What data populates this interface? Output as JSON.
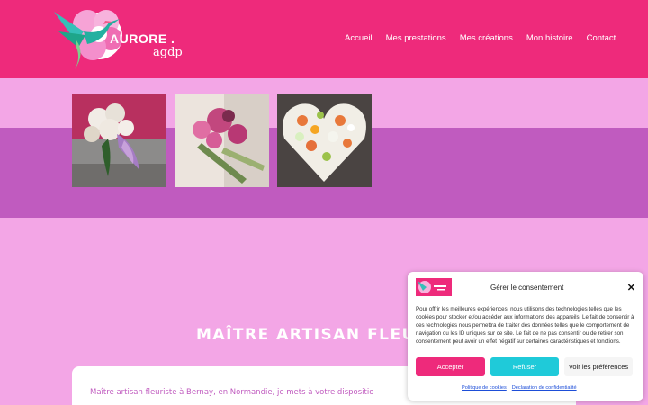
{
  "header": {
    "logo_word": "AURORE .",
    "logo_sub": "agdp",
    "nav": [
      "Accueil",
      "Mes prestations",
      "Mes créations",
      "Mon histoire",
      "Contact"
    ]
  },
  "gallery": {
    "images": [
      {
        "name": "bouquet-white-roses",
        "colors": [
          "#eae6e2",
          "#b58ac9",
          "#2f5e2b"
        ]
      },
      {
        "name": "bouquet-pink-lilies",
        "colors": [
          "#d65c97",
          "#7b2b4e",
          "#e8d7d0"
        ]
      },
      {
        "name": "heart-arrangement",
        "colors": [
          "#e8783a",
          "#f3f3ec",
          "#9bc24a"
        ]
      }
    ]
  },
  "main": {
    "heading": "MAÎTRE ARTISAN FLEUR",
    "card_text": "Maître artisan fleuriste à Bernay, en Normandie, je mets à votre dispositio"
  },
  "cookie": {
    "title": "Gérer le consentement",
    "body": "Pour offrir les meilleures expériences, nous utilisons des technologies telles que les cookies pour stocker et/ou accéder aux informations des appareils. Le fait de consentir à ces technologies nous permettra de traiter des données telles que le comportement de navigation ou les ID uniques sur ce site. Le fait de ne pas consentir ou de retirer son consentement peut avoir un effet négatif sur certaines caractéristiques et fonctions.",
    "accept": "Accepter",
    "refuse": "Refuser",
    "preferences": "Voir les préférences",
    "link_cookies": "Politique de cookies",
    "link_privacy": "Déclaration de confidentialité"
  },
  "colors": {
    "brand_pink": "#ee2a7b",
    "light_pink": "#f3a6e6",
    "purple": "#c05bbf",
    "cyan": "#1fcad9"
  }
}
